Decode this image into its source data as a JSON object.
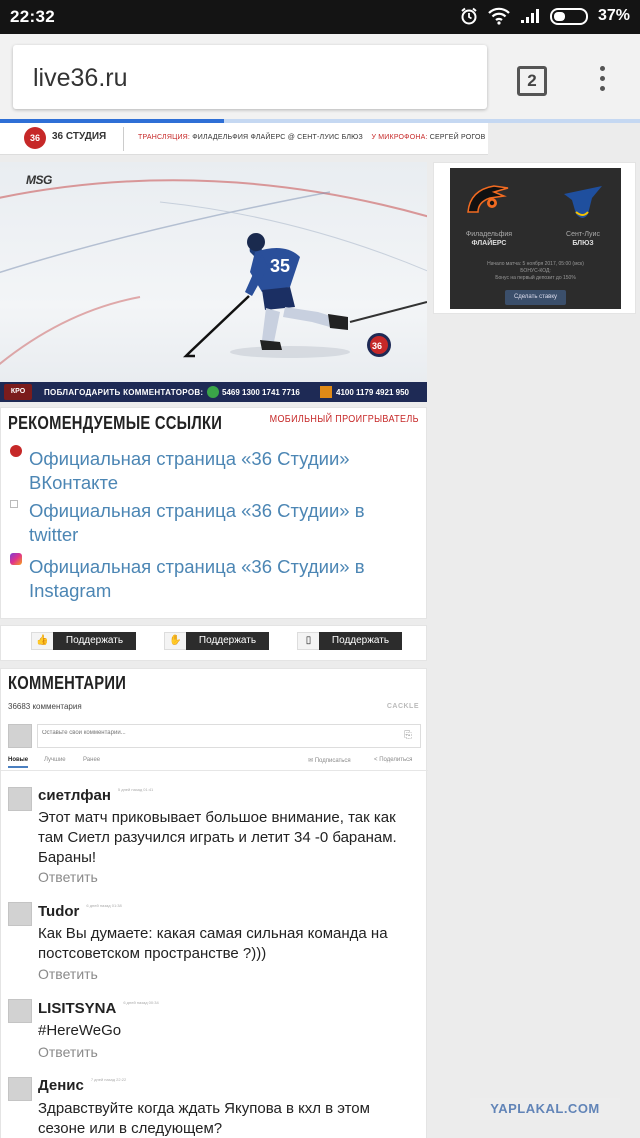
{
  "status_bar": {
    "time": "22:32",
    "battery_percent": "37%",
    "battery_level": 0.37
  },
  "browser": {
    "url": "live36.ru",
    "tab_count": "2",
    "load_progress": 0.35
  },
  "site_header": {
    "logo_mark": "36",
    "logo_text": "36 СТУДИЯ",
    "broadcast_label": "ТРАНСЛЯЦИЯ:",
    "broadcast_value": "ФИЛАДЕЛЬФИЯ ФЛАЙЕРС @ СЕНТ-ЛУИС БЛЮЗ",
    "mic_label": "У МИКРОФОНА:",
    "mic_value": "СЕРГЕЙ РОГОВ"
  },
  "video": {
    "channel_logo": "MSG",
    "jersey_number": "35",
    "bottom_logo": "КРО",
    "thanks_label": "ПОБЛАГОДАРИТЬ КОММЕНТАТОРОВ:",
    "number1": "5469 1300 1741 7716",
    "number2": "4100 1179 4921 950"
  },
  "ad": {
    "team1_city": "Филадельфия",
    "team1_name": "ФЛАЙЕРС",
    "team2_city": "Сент-Луис",
    "team2_name": "БЛЮЗ",
    "info_line1": "Начало матча: 5 ноября 2017, 05:00 (мск)",
    "info_line2": "БОНУС-КОД:",
    "info_line3": "Бонус на первый депозит до 150%",
    "button_label": "Сделать ставку"
  },
  "recommended": {
    "title": "РЕКОМЕНДУЕМЫЕ ССЫЛКИ",
    "mobile_player": "МОБИЛЬНЫЙ ПРОИГРЫВАТЕЛЬ",
    "links": [
      {
        "text": "Официальная страница «36 Студии» ВКонтакте",
        "icon": "vk-icon"
      },
      {
        "text": "Официальная страница «36 Студии» в twitter",
        "icon": "twitter-icon"
      },
      {
        "text": "Официальная страница «36 Студии» в Instagram",
        "icon": "instagram-icon"
      }
    ]
  },
  "support": {
    "buttons": [
      {
        "icon": "thumbs-up-icon",
        "glyph": "👍",
        "label": "Поддержать"
      },
      {
        "icon": "hand-icon",
        "glyph": "✋",
        "label": "Поддержать"
      },
      {
        "icon": "phone-icon",
        "glyph": "▯",
        "label": "Поддержать"
      }
    ]
  },
  "comments": {
    "title": "КОММЕНТАРИИ",
    "count": "36683 комментария",
    "brand": "CACKLE",
    "input_placeholder": "Оставьте свой комментарий...",
    "tabs": [
      "Новые",
      "Лучшие",
      "Ранее"
    ],
    "subscribe": "Подписаться",
    "share": "Поделиться",
    "reply_label": "Ответить",
    "items": [
      {
        "author": "сиетлфан",
        "date": "5 дней назад 01:41",
        "text": "Этот матч приковывает большое внимание, так как там Сиетл разучился играть и летит 34 -0 баранам. Бараны!"
      },
      {
        "author": "Tudor",
        "date": "6 дней назад 01:38",
        "text": "Как Вы думаете: какая самая сильная команда на постсоветском пространстве ?)))"
      },
      {
        "author": "LISITSYNA",
        "date": "6 дней назад 00:34",
        "text": "#HereWeGo"
      },
      {
        "author": "Денис",
        "date": "7 дней назад 22:22",
        "text": "Здравствуйте когда ждать Якупова в кхл в этом сезоне или в следующем?"
      }
    ]
  },
  "watermark": "YAPLAKAL.COM"
}
